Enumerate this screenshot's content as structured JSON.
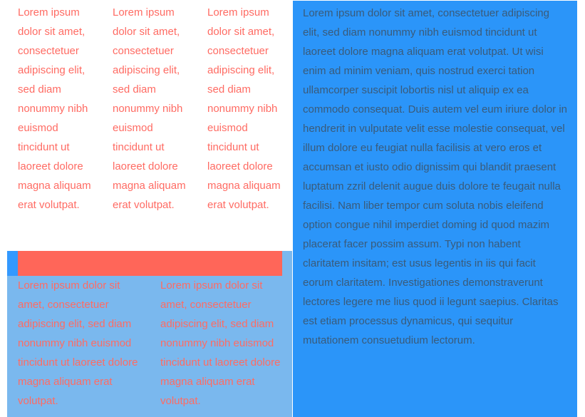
{
  "columns_three": [
    "Lorem ipsum dolor sit amet, consectetuer adipiscing elit, sed diam nonummy nibh euismod tincidunt ut laoreet dolore magna aliquam erat volutpat.",
    "Lorem ipsum dolor sit amet, consectetuer adipiscing elit, sed diam nonummy nibh euismod tincidunt ut laoreet dolore magna aliquam erat volutpat.",
    "Lorem ipsum dolor sit amet, consectetuer adipiscing elit, sed diam nonummy nibh euismod tincidunt ut laoreet dolore magna aliquam erat volutpat."
  ],
  "columns_two": [
    "Lorem ipsum dolor sit amet, consectetuer adipiscing elit, sed diam nonummy nibh euismod tincidunt ut laoreet dolore magna aliquam erat volutpat.",
    "Lorem ipsum dolor sit amet, consectetuer adipiscing elit, sed diam nonummy nibh euismod tincidunt ut laoreet dolore magna aliquam erat volutpat."
  ],
  "right_panel_text": "Lorem ipsum dolor sit amet, consectetuer adipiscing elit, sed diam nonummy nibh euismod tincidunt ut laoreet dolore magna aliquam erat volutpat. Ut wisi enim ad minim veniam, quis nostrud exerci tation ullamcorper suscipit lobortis nisl ut aliquip ex ea commodo consequat. Duis autem vel eum iriure dolor in hendrerit in vulputate velit esse molestie consequat, vel illum dolore eu feugiat nulla facilisis at vero eros et accumsan et iusto odio dignissim qui blandit praesent luptatum zzril delenit augue duis dolore te feugait nulla facilisi. Nam liber tempor cum soluta nobis eleifend option congue nihil imperdiet doming id quod mazim placerat facer possim assum. Typi non habent claritatem insitam; est usus legentis in iis qui facit eorum claritatem. Investigationes demonstraverunt lectores legere me lius quod ii legunt saepius. Claritas est etiam processus dynamicus, qui sequitur mutationem consuetudium lectorum.",
  "colors": {
    "accent_red": "#ff6659",
    "text_red": "#ff6b63",
    "panel_blue": "#2b95f9",
    "light_blue": "#7ab8ee",
    "text_dark": "#3a5b7a"
  }
}
